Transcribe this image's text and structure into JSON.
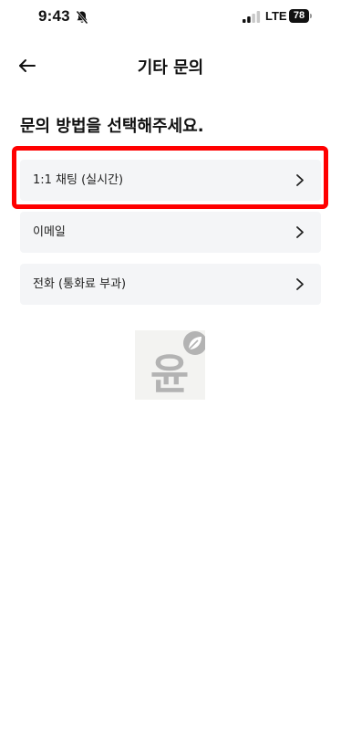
{
  "status_bar": {
    "time": "9:43",
    "network": "LTE",
    "battery": "78"
  },
  "header": {
    "title": "기타 문의"
  },
  "main": {
    "heading": "문의 방법을 선택해주세요.",
    "options": [
      {
        "label": "1:1 채팅 (실시간)"
      },
      {
        "label": "이메일"
      },
      {
        "label": "전화 (통화료 부과)"
      }
    ]
  },
  "watermark": {
    "text": "윤"
  },
  "colors": {
    "highlight": "#ff0000",
    "option_background": "#f4f5f7"
  }
}
